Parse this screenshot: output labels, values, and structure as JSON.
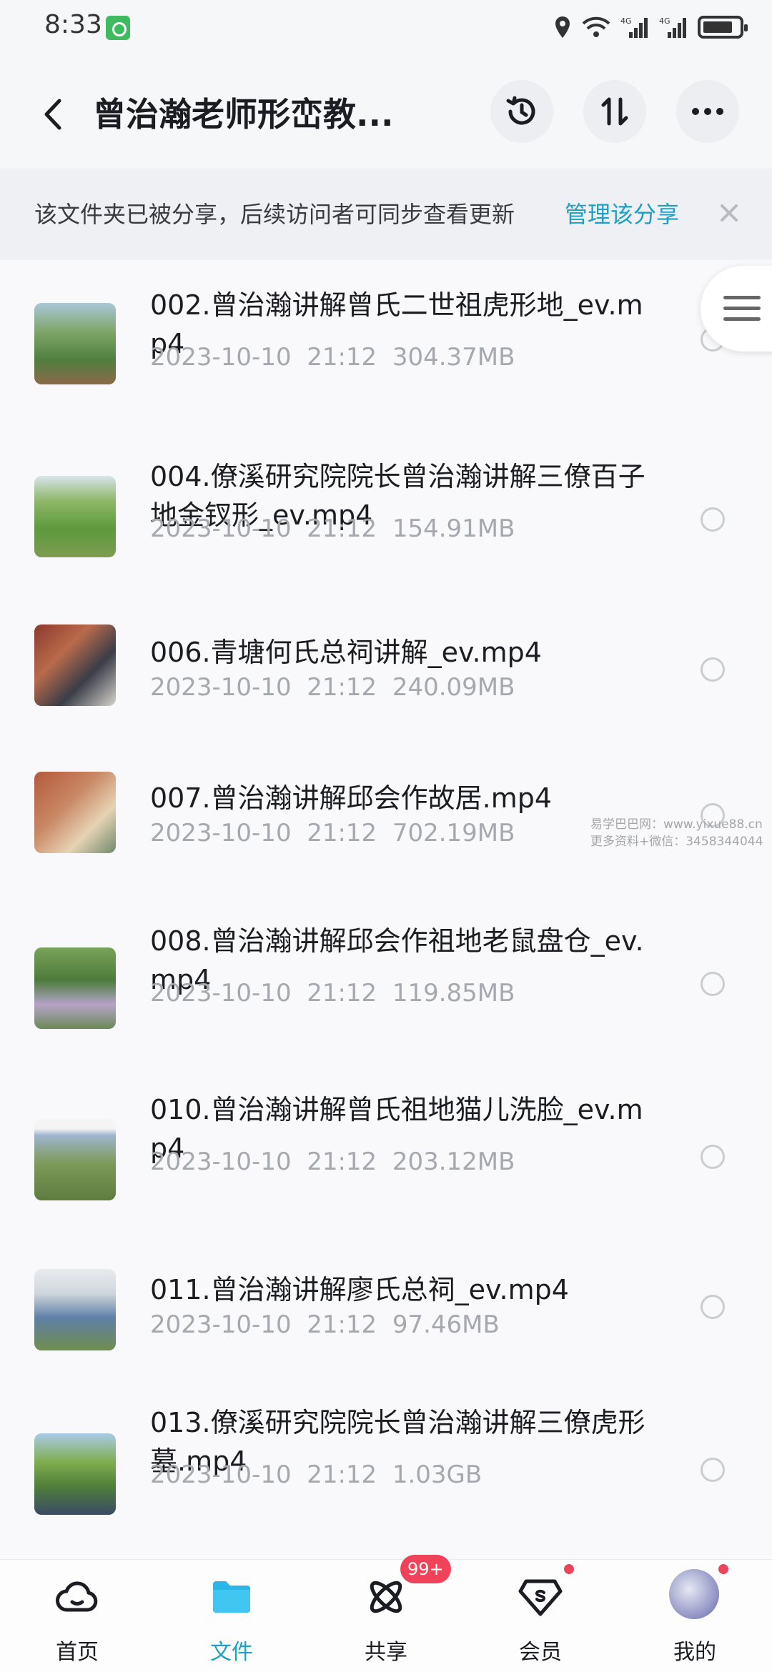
{
  "status_bar": {
    "time": "8:33",
    "network_1": "4G",
    "network_2": "4G"
  },
  "header": {
    "title": "曾治瀚老师形峦教...",
    "icons": [
      "back-icon",
      "history-icon",
      "sort-icon",
      "more-icon"
    ]
  },
  "share_banner": {
    "text": "该文件夹已被分享，后续访问者可同步查看更新",
    "manage_label": "管理该分享",
    "close_icon": "close-icon"
  },
  "files": [
    {
      "name": "002.曾治瀚讲解曾氏二世祖虎形地_ev.mp4",
      "date": "2023-10-10  21:12",
      "size": "304.37MB"
    },
    {
      "name": "004.僚溪研究院院长曾治瀚讲解三僚百子地金钗形_ev.mp4",
      "date": "2023-10-10  21:12",
      "size": "154.91MB"
    },
    {
      "name": "006.青塘何氏总祠讲解_ev.mp4",
      "date": "2023-10-10  21:12",
      "size": "240.09MB"
    },
    {
      "name": "007.曾治瀚讲解邱会作故居.mp4",
      "date": "2023-10-10  21:12",
      "size": "702.19MB"
    },
    {
      "name": "008.曾治瀚讲解邱会作祖地老鼠盘仓_ev.mp4",
      "date": "2023-10-10  21:12",
      "size": "119.85MB"
    },
    {
      "name": "010.曾治瀚讲解曾氏祖地猫儿洗脸_ev.mp4",
      "date": "2023-10-10  21:12",
      "size": "203.12MB"
    },
    {
      "name": "011.曾治瀚讲解廖氏总祠_ev.mp4",
      "date": "2023-10-10  21:12",
      "size": "97.46MB"
    },
    {
      "name": "013.僚溪研究院院长曾治瀚讲解三僚虎形墓.mp4",
      "date": "2023-10-10  21:12",
      "size": "1.03GB"
    }
  ],
  "watermark": {
    "line1": "易学巴巴网：www.yixue88.cn",
    "line2": "更多资料+微信：3458344044"
  },
  "tabbar": {
    "tabs": [
      {
        "label": "首页",
        "icon": "cloud-icon"
      },
      {
        "label": "文件",
        "icon": "folder-icon"
      },
      {
        "label": "共享",
        "icon": "share-orbit-icon"
      },
      {
        "label": "会员",
        "icon": "vip-diamond-icon"
      },
      {
        "label": "我的",
        "icon": "avatar"
      }
    ],
    "share_badge": "99+",
    "active_index": 1
  },
  "colors": {
    "accent": "#1fa0c4",
    "badge": "#f0435a",
    "folder": "#2bb6e8"
  }
}
